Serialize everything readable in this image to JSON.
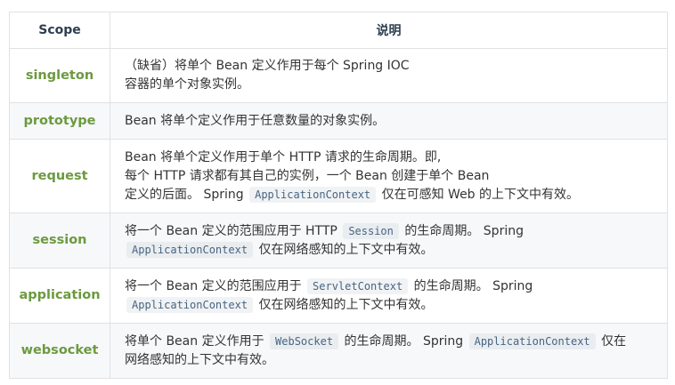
{
  "table": {
    "headers": [
      "Scope",
      "说明"
    ],
    "rows": [
      {
        "scope": "singleton",
        "lines": [
          [
            "（缺省）将单个 Bean 定义作用于每个 Spring IOC"
          ],
          [
            "容器的单个对象实例。"
          ]
        ]
      },
      {
        "scope": "prototype",
        "lines": [
          [
            "Bean 将单个定义作用于任意数量的对象实例。"
          ]
        ]
      },
      {
        "scope": "request",
        "lines": [
          [
            "Bean 将单个定义作用于单个 HTTP 请求的生命周期。即,"
          ],
          [
            "每个 HTTP 请求都有其自己的实例，一个 Bean 创建于单个 Bean"
          ],
          [
            "定义的后面。 Spring ",
            {
              "code": "ApplicationContext"
            },
            " 仅在可感知 Web 的上下文中有效。"
          ]
        ]
      },
      {
        "scope": "session",
        "lines": [
          [
            "将一个 Bean 定义的范围应用于 HTTP ",
            {
              "code": "Session"
            },
            " 的生命周期。 Spring"
          ],
          [
            {
              "code": "ApplicationContext"
            },
            " 仅在网络感知的上下文中有效。"
          ]
        ]
      },
      {
        "scope": "application",
        "lines": [
          [
            "将一个 Bean 定义的范围应用于 ",
            {
              "code": "ServletContext"
            },
            " 的生命周期。 Spring"
          ],
          [
            {
              "code": "ApplicationContext"
            },
            " 仅在网络感知的上下文中有效。"
          ]
        ]
      },
      {
        "scope": "websocket",
        "lines": [
          [
            "将单个 Bean 定义作用于 ",
            {
              "code": "WebSocket"
            },
            " 的生命周期。 Spring ",
            {
              "code": "ApplicationContext"
            },
            " 仅在"
          ],
          [
            "网络感知的上下文中有效。"
          ]
        ]
      }
    ]
  }
}
